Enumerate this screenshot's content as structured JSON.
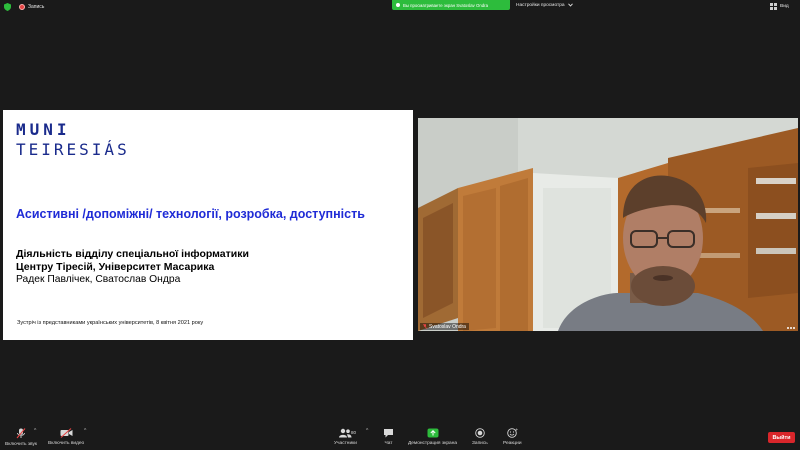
{
  "topbar": {
    "recording_label": "Запись",
    "share_banner": "Вы просматриваете экран Svatoslav Ondra",
    "view_options": "Настройки просмотра",
    "view_button": "Вид"
  },
  "slide": {
    "logo_line1": "MUNI",
    "logo_line2": "TEIRESIÁS",
    "title": "Асистивні /допоміжні/ технології, розробка, доступність",
    "line1": "Діяльність відділу спеціальної інформатики",
    "line2": "Центру Тіресій, Університет Масарика",
    "line3": "Радек Павлічек, Сватослав Ондра",
    "footer": "Зустріч із представниками українських університетів, 8 квітня 2021 року"
  },
  "camera": {
    "participant_name": "Svatoslav Ondra"
  },
  "toolbar": {
    "mute_label": "Включить звук",
    "video_label": "Включить видео",
    "participants_label": "Участники",
    "participants_count": "80",
    "chat_label": "Чат",
    "share_label": "Демонстрация экрана",
    "record_label": "Запись",
    "reactions_label": "Реакции",
    "leave_label": "Выйти"
  },
  "colors": {
    "background": "#1a1a1a",
    "share_green": "#2dbc3c",
    "leave_red": "#d9262b",
    "slide_title_blue": "#1f2bd6",
    "logo_blue": "#1a2b8c"
  }
}
